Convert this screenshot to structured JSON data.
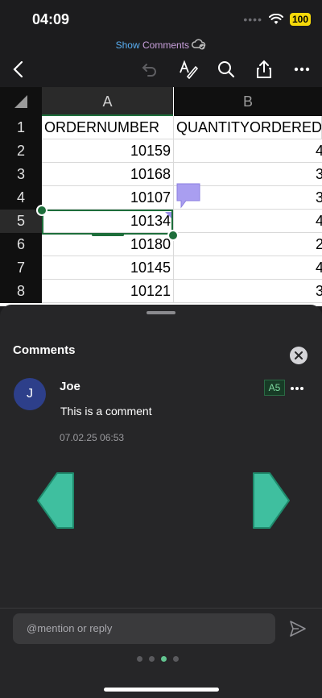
{
  "status": {
    "time": "04:09",
    "signal": "••••",
    "battery": "100"
  },
  "header": {
    "show": "Show",
    "comments": "Comments"
  },
  "toolbar": {
    "icons": [
      "back-arrow-icon",
      "undo-icon",
      "text-format-icon",
      "search-icon",
      "share-icon",
      "more-icon"
    ]
  },
  "sheet": {
    "columns": [
      "A",
      "B"
    ],
    "rows": [
      {
        "num": "1",
        "a": "ORDERNUMBER",
        "b": "QUANTITYORDERED"
      },
      {
        "num": "2",
        "a": "10159",
        "b": "4"
      },
      {
        "num": "3",
        "a": "10168",
        "b": "3"
      },
      {
        "num": "4",
        "a": "10107",
        "b": "3"
      },
      {
        "num": "5",
        "a": "10134",
        "b": "4"
      },
      {
        "num": "6",
        "a": "10180",
        "b": "2"
      },
      {
        "num": "7",
        "a": "10145",
        "b": "4"
      },
      {
        "num": "8",
        "a": "10121",
        "b": "3"
      }
    ],
    "selected_cell": "A5"
  },
  "comments_panel": {
    "title": "Comments",
    "comment": {
      "avatar_initial": "J",
      "author": "Joe",
      "cell_ref": "A5",
      "text": "This is a comment",
      "timestamp": "07.02.25 06:53"
    },
    "reply_placeholder": "@mention or reply",
    "page_count": 4,
    "active_page": 3
  },
  "colors": {
    "accent_green": "#1e6e3b",
    "nav_arrow": "#3fbf9f",
    "comment_marker": "#a99ef0"
  }
}
